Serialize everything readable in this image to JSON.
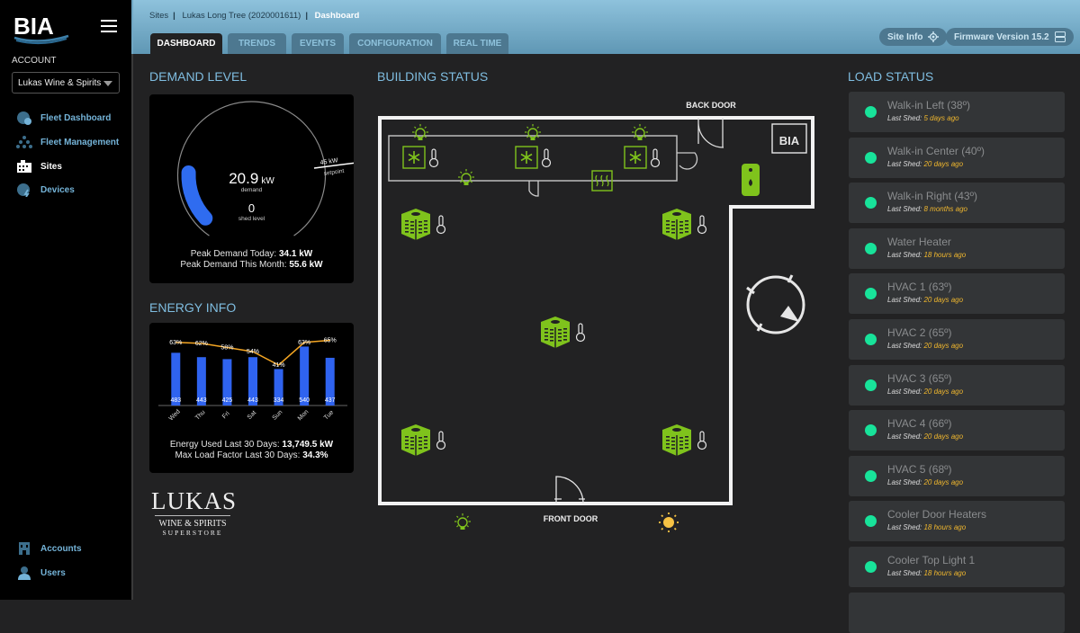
{
  "brand": {
    "logo_text": "BIA"
  },
  "sidebar": {
    "account_label": "ACCOUNT",
    "account_selected": "Lukas Wine & Spirits",
    "nav": [
      {
        "label": "Fleet Dashboard",
        "icon": "fleet-dashboard-icon"
      },
      {
        "label": "Fleet Management",
        "icon": "fleet-management-icon"
      },
      {
        "label": "Sites",
        "icon": "sites-icon",
        "active": true
      },
      {
        "label": "Devices",
        "icon": "devices-icon"
      }
    ],
    "bottom_nav": [
      {
        "label": "Accounts",
        "icon": "accounts-icon"
      },
      {
        "label": "Users",
        "icon": "users-icon"
      }
    ]
  },
  "header": {
    "breadcrumb": [
      "Sites",
      "Lukas Long Tree (2020001611)",
      "Dashboard"
    ],
    "tabs": [
      "DASHBOARD",
      "TRENDS",
      "EVENTS",
      "CONFIGURATION",
      "REAL TIME"
    ],
    "active_tab": "DASHBOARD",
    "site_info_label": "Site Info",
    "firmware_label": "Firmware Version 15.2"
  },
  "demand": {
    "title": "DEMAND LEVEL",
    "value": "20.9",
    "unit": "kW",
    "value_label": "demand",
    "shed_level": "0",
    "shed_label": "shed level",
    "setpoint_value": "45 kW",
    "setpoint_label": "setpoint",
    "demand_fraction_of_setpoint": 0.46,
    "peak_today_label": "Peak Demand Today:",
    "peak_today": "34.1 kW",
    "peak_month_label": "Peak Demand This Month:",
    "peak_month": "55.6 kW"
  },
  "energy": {
    "title": "ENERGY INFO",
    "used_label": "Energy Used Last 30 Days:",
    "used_value": "13,749.5 kW",
    "load_factor_label": "Max Load Factor Last 30 Days:",
    "load_factor_value": "34.3%"
  },
  "chart_data": {
    "type": "bar",
    "categories": [
      "Wed",
      "Thu",
      "Fri",
      "Sat",
      "Sun",
      "Mon",
      "Tue"
    ],
    "series": [
      {
        "name": "Energy",
        "type": "bar",
        "values": [
          483,
          443,
          425,
          443,
          334,
          540,
          437
        ]
      },
      {
        "name": "Load Factor",
        "type": "line",
        "values": [
          63,
          62,
          58,
          54,
          41,
          63,
          65
        ],
        "unit": "%"
      }
    ],
    "ylim": [
      0,
      560
    ],
    "colors": {
      "bar": "#2f63ef",
      "line": "#f5a623"
    }
  },
  "building": {
    "title": "BUILDING STATUS",
    "back_door_label": "BACK DOOR",
    "front_door_label": "FRONT DOOR",
    "colors": {
      "active": "#7fc31c",
      "outline": "#e8e8e8",
      "sun": "#f6c244"
    }
  },
  "load_status": {
    "title": "LOAD STATUS",
    "last_shed_label": "Last Shed:",
    "items": [
      {
        "name": "Walk-in Left (38º)",
        "last_shed": "5 days ago"
      },
      {
        "name": "Walk-in Center (40º)",
        "last_shed": "20 days ago"
      },
      {
        "name": "Walk-in Right (43º)",
        "last_shed": "8 months ago"
      },
      {
        "name": "Water Heater",
        "last_shed": "18 hours ago"
      },
      {
        "name": "HVAC 1 (63º)",
        "last_shed": "20 days ago"
      },
      {
        "name": "HVAC 2 (65º)",
        "last_shed": "20 days ago"
      },
      {
        "name": "HVAC 3 (65º)",
        "last_shed": "20 days ago"
      },
      {
        "name": "HVAC 4 (66º)",
        "last_shed": "20 days ago"
      },
      {
        "name": "HVAC 5 (68º)",
        "last_shed": "20 days ago"
      },
      {
        "name": "Cooler Door Heaters",
        "last_shed": "18 hours ago"
      },
      {
        "name": "Cooler Top Light 1",
        "last_shed": "18 hours ago"
      }
    ],
    "status_color": "#18e39a"
  },
  "customer_logo": {
    "line1": "LUKAS",
    "line2": "WINE & SPIRITS",
    "line3": "SUPERSTORE"
  }
}
